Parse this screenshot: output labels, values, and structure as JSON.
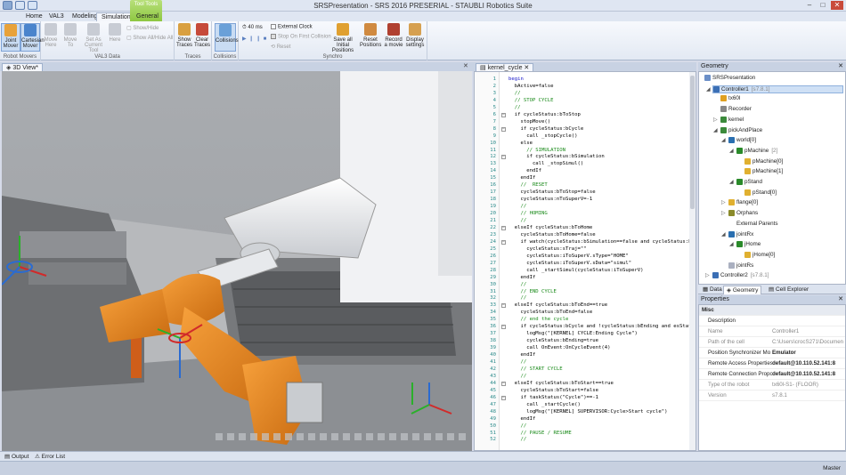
{
  "window": {
    "title": "SRSPresentation - SRS 2016 PRESERIAL - STAUBLI Robotics Suite"
  },
  "tabs": [
    "Home",
    "VAL3",
    "Modeling",
    "Simulation",
    "General"
  ],
  "context_tab": "Tool Tools",
  "ribbon": {
    "groups": [
      {
        "label": "Robot Movers",
        "buttons": [
          "Joint Mover",
          "Cartesian Mover"
        ]
      },
      {
        "label": "VAL3 Data",
        "buttons": [
          "Move Here",
          "Move To",
          "Set As Current Tool",
          "Here"
        ],
        "smalls": [
          "Show/Hide",
          "Show All/Hide All"
        ]
      },
      {
        "label": "Traces",
        "buttons": [
          "Show Traces",
          "Clear Traces"
        ]
      },
      {
        "label": "Collisions",
        "buttons": [
          "Collisions"
        ]
      },
      {
        "label": "Synchro",
        "speed": "40 ms",
        "checks": [
          "External Clock",
          "Stop On First Collision"
        ],
        "reset": "Reset",
        "buttons": [
          "Save all Initial Positions",
          "Reset Positions",
          "Record a movie",
          "Display settings"
        ]
      }
    ]
  },
  "view": {
    "tab": "3D View*"
  },
  "editor": {
    "tab": "kernel_cycle",
    "lines": [
      {
        "n": "1",
        "t": "begin",
        "k": "kw"
      },
      {
        "n": "2",
        "t": "  bActive=false"
      },
      {
        "n": "3",
        "t": "  //",
        "k": "cm"
      },
      {
        "n": "4",
        "t": "  // STOP CYCLE",
        "k": "cm"
      },
      {
        "n": "5",
        "t": "  //",
        "k": "cm"
      },
      {
        "n": "6",
        "t": "  if cycleStatus:bToStop",
        "f": "-"
      },
      {
        "n": "7",
        "t": "    stopMove()"
      },
      {
        "n": "8",
        "t": "    if cycleStatus:bCycle",
        "f": "-"
      },
      {
        "n": "9",
        "t": "      call _stopCycle()"
      },
      {
        "n": "10",
        "t": "    else"
      },
      {
        "n": "11",
        "t": "      // SIMULATION",
        "k": "cm"
      },
      {
        "n": "12",
        "t": "      if cycleStatus:bSimulation",
        "f": "-"
      },
      {
        "n": "13",
        "t": "        call _stopSimul()"
      },
      {
        "n": "14",
        "t": "      endIf"
      },
      {
        "n": "15",
        "t": "    endIf"
      },
      {
        "n": "16",
        "t": "    //  RESET",
        "k": "cm"
      },
      {
        "n": "17",
        "t": "    cycleStatus:bToStop=false"
      },
      {
        "n": "18",
        "t": "    cycleStatus:nToSuperV=-1"
      },
      {
        "n": "19",
        "t": "    //",
        "k": "cm"
      },
      {
        "n": "20",
        "t": "    // HOMING",
        "k": "cm"
      },
      {
        "n": "21",
        "t": "    //",
        "k": "cm"
      },
      {
        "n": "22",
        "t": "  elseIf cycleStatus:bToHome",
        "f": "-"
      },
      {
        "n": "23",
        "t": "    cycleStatus:bToHome=false"
      },
      {
        "n": "24",
        "t": "    if watch(cycleStatus:bSimulation==false and cycleStatus:bC",
        "f": "-"
      },
      {
        "n": "25",
        "t": "      cycleStatus:sTraj=\"\""
      },
      {
        "n": "26",
        "t": "      cycleStatus:iToSuperV.sType=\"HOME\""
      },
      {
        "n": "27",
        "t": "      cycleStatus:iToSuperV.sData=\"simul\""
      },
      {
        "n": "28",
        "t": "      call _startSimul(cycleStatus:iToSuperV)"
      },
      {
        "n": "29",
        "t": "    endIf"
      },
      {
        "n": "30",
        "t": "    //",
        "k": "cm"
      },
      {
        "n": "31",
        "t": "    // END CYCLE",
        "k": "cm"
      },
      {
        "n": "32",
        "t": "    //",
        "k": "cm"
      },
      {
        "n": "33",
        "t": "  elseIf cycleStatus:bToEnd==true",
        "f": "-"
      },
      {
        "n": "34",
        "t": "    cycleStatus:bToEnd=false"
      },
      {
        "n": "35",
        "t": "    // end the cycle",
        "k": "cm"
      },
      {
        "n": "36",
        "t": "    if cycleStatus:bCycle and !cycleStatus:bEnding and esStatu",
        "f": "-"
      },
      {
        "n": "37",
        "t": "      logMsg(\"[KERNEL] CYCLE:Ending Cycle\")"
      },
      {
        "n": "38",
        "t": "      cycleStatus:bEnding=true"
      },
      {
        "n": "39",
        "t": "      call OnEvent:OnCycleEvent(4)"
      },
      {
        "n": "40",
        "t": "    endIf"
      },
      {
        "n": "41",
        "t": "    //",
        "k": "cm"
      },
      {
        "n": "42",
        "t": "    // START CYCLE",
        "k": "cm"
      },
      {
        "n": "43",
        "t": "    //",
        "k": "cm"
      },
      {
        "n": "44",
        "t": "  elseIf cycleStatus:bToStart==true",
        "f": "-"
      },
      {
        "n": "45",
        "t": "    cycleStatus:bToStart=false"
      },
      {
        "n": "46",
        "t": "    if taskStatus(\"Cycle\")==-1",
        "f": "-"
      },
      {
        "n": "47",
        "t": "      call _startCycle()"
      },
      {
        "n": "48",
        "t": "      logMsg(\"[KERNEL] SUPERVISOR:Cycle>Start cycle\")"
      },
      {
        "n": "49",
        "t": "    endIf"
      },
      {
        "n": "50",
        "t": "    //",
        "k": "cm"
      },
      {
        "n": "51",
        "t": "    // PAUSE / RESUME",
        "k": "cm"
      },
      {
        "n": "52",
        "t": "    //",
        "k": "cm"
      }
    ]
  },
  "geometry": {
    "title": "Geometry",
    "tree": [
      {
        "label": "SRSPresentation",
        "indent": 0,
        "color": "#6b8fc7"
      },
      {
        "label": "Controller1",
        "ver": "[s7.8.1]",
        "indent": 1,
        "color": "#3b6fb5",
        "sel": true,
        "exp": "v"
      },
      {
        "label": "tx60l",
        "indent": 2,
        "color": "#e0a020"
      },
      {
        "label": "Recorder",
        "indent": 2,
        "color": "#888888"
      },
      {
        "label": "kernel",
        "indent": 2,
        "color": "#3b8a3b",
        "exp": ">"
      },
      {
        "label": "pickAndPlace",
        "indent": 2,
        "color": "#3b8a3b",
        "exp": "v"
      },
      {
        "label": "world[0]",
        "indent": 3,
        "color": "#2a6fb0",
        "exp": "v"
      },
      {
        "label": "pMachine",
        "ver": "[2]",
        "indent": 4,
        "color": "#2a8a2a",
        "exp": "v"
      },
      {
        "label": "pMachine[0]",
        "indent": 5,
        "color": "#e0b030"
      },
      {
        "label": "pMachine[1]",
        "indent": 5,
        "color": "#e0b030"
      },
      {
        "label": "pStand",
        "indent": 4,
        "color": "#2a8a2a",
        "exp": "v"
      },
      {
        "label": "pStand[0]",
        "indent": 5,
        "color": "#e0b030"
      },
      {
        "label": "flange[0]",
        "indent": 3,
        "color": "#e0b030",
        "exp": ">"
      },
      {
        "label": "Orphans",
        "indent": 3,
        "color": "#8a8a2a",
        "exp": ">"
      },
      {
        "label": "External Parents",
        "indent": 3,
        "color": "#ffffff"
      },
      {
        "label": "jointRx",
        "indent": 3,
        "color": "#2a6fb0",
        "exp": "v"
      },
      {
        "label": "jHome",
        "indent": 4,
        "color": "#2a8a2a",
        "exp": "v"
      },
      {
        "label": "jHome[0]",
        "indent": 5,
        "color": "#e0b030"
      },
      {
        "label": "jointRs",
        "indent": 3,
        "color": "#aab0c0"
      },
      {
        "label": "Controller2",
        "ver": "[s7.8.1]",
        "indent": 1,
        "color": "#3b6fb5",
        "exp": ">"
      }
    ],
    "panel_tabs": [
      "Data",
      "Geometry",
      "Cell Explorer"
    ]
  },
  "properties": {
    "title": "Properties",
    "category": "Misc",
    "rows": [
      {
        "k": "Description",
        "v": "",
        "gray": false
      },
      {
        "k": "Name",
        "v": "Controller1",
        "gray": true
      },
      {
        "k": "Path of the cell",
        "v": "C:\\Users\\crocS271\\Documents",
        "gray": true
      },
      {
        "k": "Position Synchronizer Mo",
        "v": "Emulator",
        "gray": false
      },
      {
        "k": "Remote Access Properties",
        "v": "default@10.110.52.141:8",
        "gray": false
      },
      {
        "k": "Remote Connection Propo",
        "v": "default@10.110.52.141:8",
        "gray": false
      },
      {
        "k": "Type of the robot",
        "v": "tx60l-S1- (FLOOR)",
        "gray": true
      },
      {
        "k": "Version",
        "v": "s7.8.1",
        "gray": true
      }
    ]
  },
  "bottom_tabs": [
    "Output",
    "Error List"
  ],
  "status": {
    "right": "Master"
  }
}
